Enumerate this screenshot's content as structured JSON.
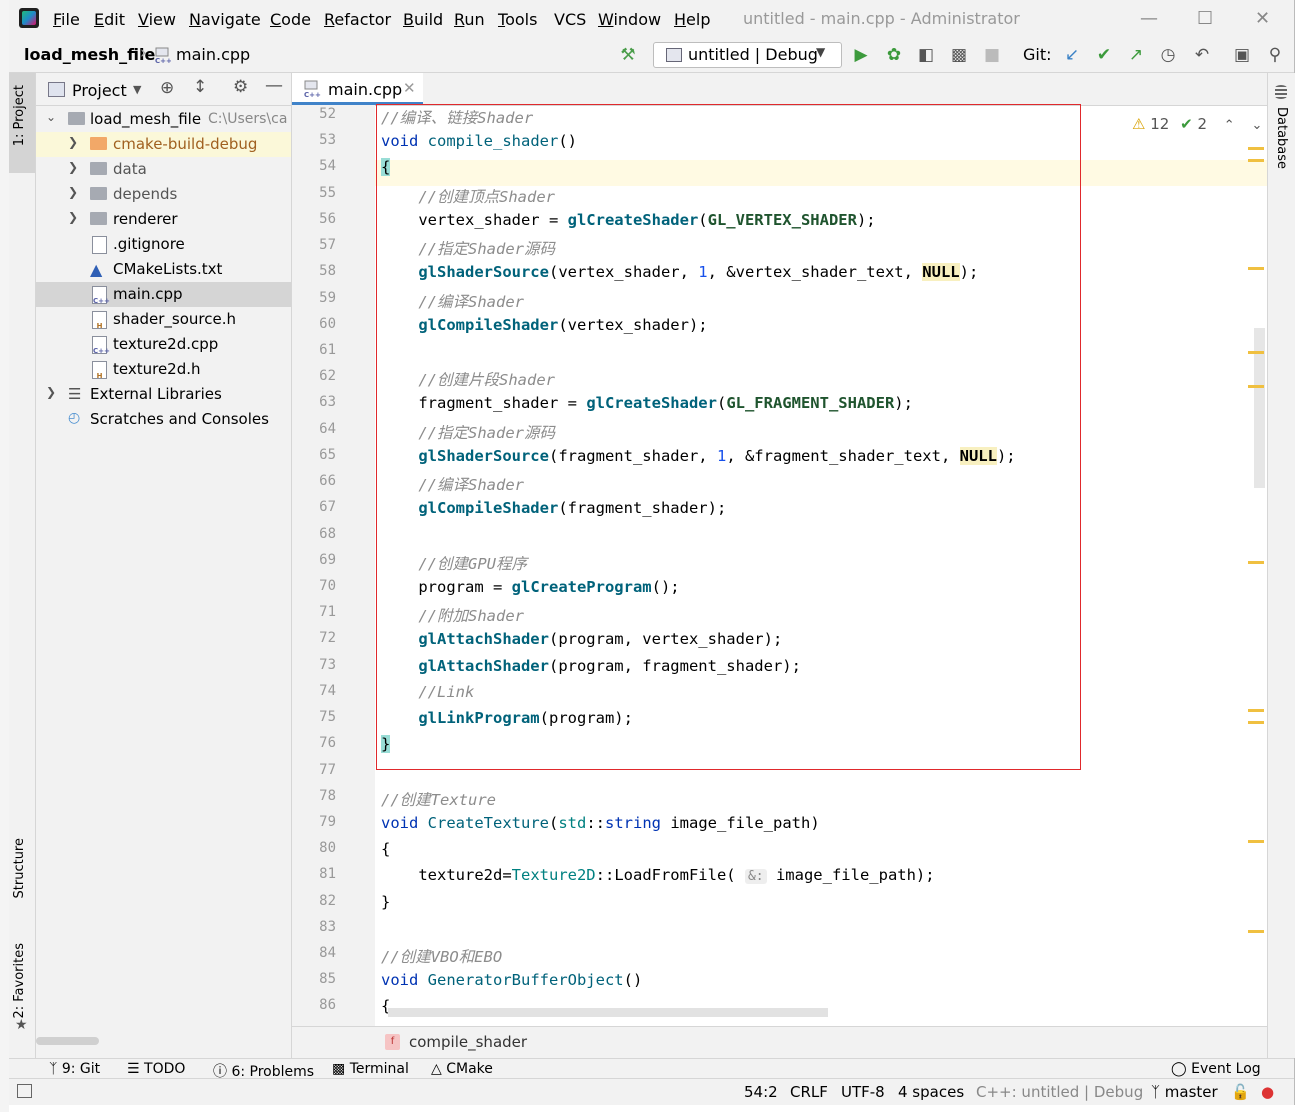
{
  "menubar": {
    "items": [
      "File",
      "Edit",
      "View",
      "Navigate",
      "Code",
      "Refactor",
      "Build",
      "Run",
      "Tools",
      "VCS",
      "Window",
      "Help"
    ],
    "underline": [
      "F",
      "E",
      "V",
      "N",
      "C",
      "R",
      "B",
      "R",
      "T",
      "",
      "W",
      "H"
    ],
    "window_title": "untitled - main.cpp - Administrator"
  },
  "navbar": {
    "project": "load_mesh_file",
    "file": "main.cpp",
    "run_config": "untitled | Debug",
    "git_label": "Git:"
  },
  "sidestrip": {
    "project": "1: Project",
    "structure": "Structure",
    "favorites": "2: Favorites",
    "database": "Database"
  },
  "project_panel": {
    "title": "Project",
    "root": "load_mesh_file",
    "root_path": "C:\\Users\\ca",
    "items": [
      {
        "label": "cmake-build-debug",
        "type": "folder-orange",
        "expandable": true
      },
      {
        "label": "data",
        "type": "folder",
        "expandable": true
      },
      {
        "label": "depends",
        "type": "folder",
        "expandable": true
      },
      {
        "label": "renderer",
        "type": "folder",
        "expandable": true
      },
      {
        "label": ".gitignore",
        "type": "file",
        "expandable": false
      },
      {
        "label": "CMakeLists.txt",
        "type": "cmake",
        "expandable": false
      },
      {
        "label": "main.cpp",
        "type": "cpp",
        "expandable": false
      },
      {
        "label": "shader_source.h",
        "type": "h",
        "expandable": false
      },
      {
        "label": "texture2d.cpp",
        "type": "cpp",
        "expandable": false
      },
      {
        "label": "texture2d.h",
        "type": "h",
        "expandable": false
      }
    ],
    "external": "External Libraries",
    "scratches": "Scratches and Consoles"
  },
  "editor": {
    "tab": "main.cpp",
    "warnings": "12",
    "weak_warnings": "2",
    "line_numbers": [
      "52",
      "53",
      "54",
      "55",
      "56",
      "57",
      "58",
      "59",
      "60",
      "61",
      "62",
      "63",
      "64",
      "65",
      "66",
      "67",
      "68",
      "69",
      "70",
      "71",
      "72",
      "73",
      "74",
      "75",
      "76",
      "77",
      "78",
      "79",
      "80",
      "81",
      "82",
      "83",
      "84",
      "85",
      "86"
    ],
    "breadcrumb_fn": "compile_shader",
    "lines": {
      "l52": "//编译、链接Shader",
      "l55": "//创建顶点Shader",
      "l56a": "vertex_shader = ",
      "l56f": "glCreateShader",
      "l56m": "GL_VERTEX_SHADER",
      "l57": "//指定Shader源码",
      "l58f": "glShaderSource",
      "l58a": "(vertex_shader, ",
      "l58n": "1",
      "l58b": ", &vertex_shader_text, ",
      "l59": "//编译Shader",
      "l60f": "glCompileShader",
      "l60a": "(vertex_shader);",
      "l62": "//创建片段Shader",
      "l63a": "fragment_shader = ",
      "l63m": "GL_FRAGMENT_SHADER",
      "l64": "//指定Shader源码",
      "l65a": "(fragment_shader, ",
      "l65b": ", &fragment_shader_text, ",
      "l66": "//编译Shader",
      "l67a": "(fragment_shader);",
      "l69": "//创建GPU程序",
      "l70a": "program = ",
      "l70f": "glCreateProgram",
      "l71": "//附加Shader",
      "l72f": "glAttachShader",
      "l72a": "(program, vertex_shader);",
      "l73a": "(program, fragment_shader);",
      "l74": "//Link",
      "l75f": "glLinkProgram",
      "l75a": "(program);",
      "l78": "//创建Texture",
      "l79fn": "CreateTexture",
      "l79ty": "std",
      "l79kw": "string",
      "l79p": " image_file_path)",
      "l81a": "texture2d=",
      "l81t": "Texture2D",
      "l81m": "::LoadFromFile( ",
      "l81h": "&:",
      "l81b": " image_file_path);",
      "l84": "//创建VBO和EBO",
      "l85fn": "GeneratorBufferObject",
      "null": "NULL",
      "void": "void",
      "compile": "compile_shader"
    }
  },
  "bottom_tools": [
    "9: Git",
    "TODO",
    "6: Problems",
    "Terminal",
    "CMake"
  ],
  "event_log": "Event Log",
  "status": {
    "position": "54:2",
    "line_sep": "CRLF",
    "encoding": "UTF-8",
    "indent": "4 spaces",
    "context": "C++: untitled | Debug",
    "branch": "master"
  }
}
